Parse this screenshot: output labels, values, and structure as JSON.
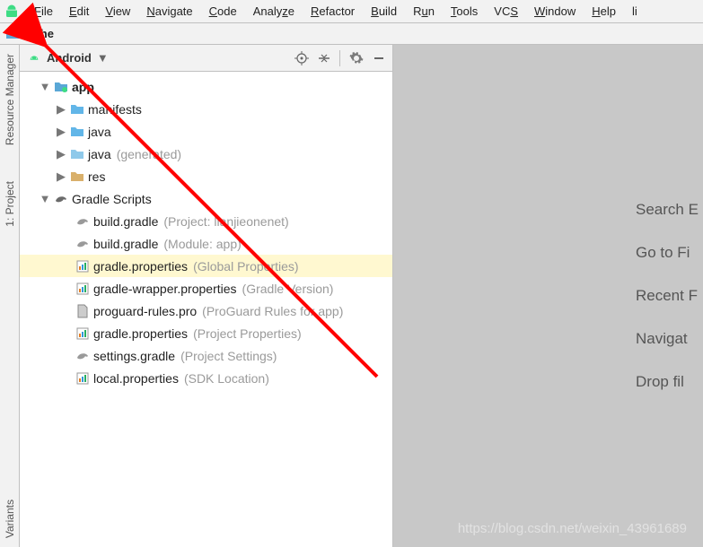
{
  "menu": {
    "items": [
      "File",
      "Edit",
      "View",
      "Navigate",
      "Code",
      "Analyze",
      "Refactor",
      "Build",
      "Run",
      "Tools",
      "VCS",
      "Window",
      "Help",
      "li"
    ]
  },
  "breadcrumb": {
    "project": "bishe"
  },
  "gutter": {
    "resource_manager": "Resource Manager",
    "project": "1: Project",
    "variants": "Variants"
  },
  "panel": {
    "title": "Android",
    "icons": {
      "target": "target",
      "collapse": "collapse",
      "gear": "gear",
      "minimize": "minimize"
    }
  },
  "tree": {
    "app": {
      "label": "app"
    },
    "manifests": {
      "label": "manifests"
    },
    "java": {
      "label": "java"
    },
    "java_gen": {
      "label": "java",
      "hint": "(generated)"
    },
    "res": {
      "label": "res"
    },
    "gradle_scripts": {
      "label": "Gradle Scripts"
    },
    "items": [
      {
        "label": "build.gradle",
        "hint": "(Project: lianjieonenet)"
      },
      {
        "label": "build.gradle",
        "hint": "(Module: app)"
      },
      {
        "label": "gradle.properties",
        "hint": "(Global Properties)"
      },
      {
        "label": "gradle-wrapper.properties",
        "hint": "(Gradle Version)"
      },
      {
        "label": "proguard-rules.pro",
        "hint": "(ProGuard Rules for app)"
      },
      {
        "label": "gradle.properties",
        "hint": "(Project Properties)"
      },
      {
        "label": "settings.gradle",
        "hint": "(Project Settings)"
      },
      {
        "label": "local.properties",
        "hint": "(SDK Location)"
      }
    ]
  },
  "editor_hints": [
    "Search E",
    "Go to Fi",
    "Recent F",
    "Navigat",
    "Drop fil"
  ],
  "watermark": "https://blog.csdn.net/weixin_43961689"
}
